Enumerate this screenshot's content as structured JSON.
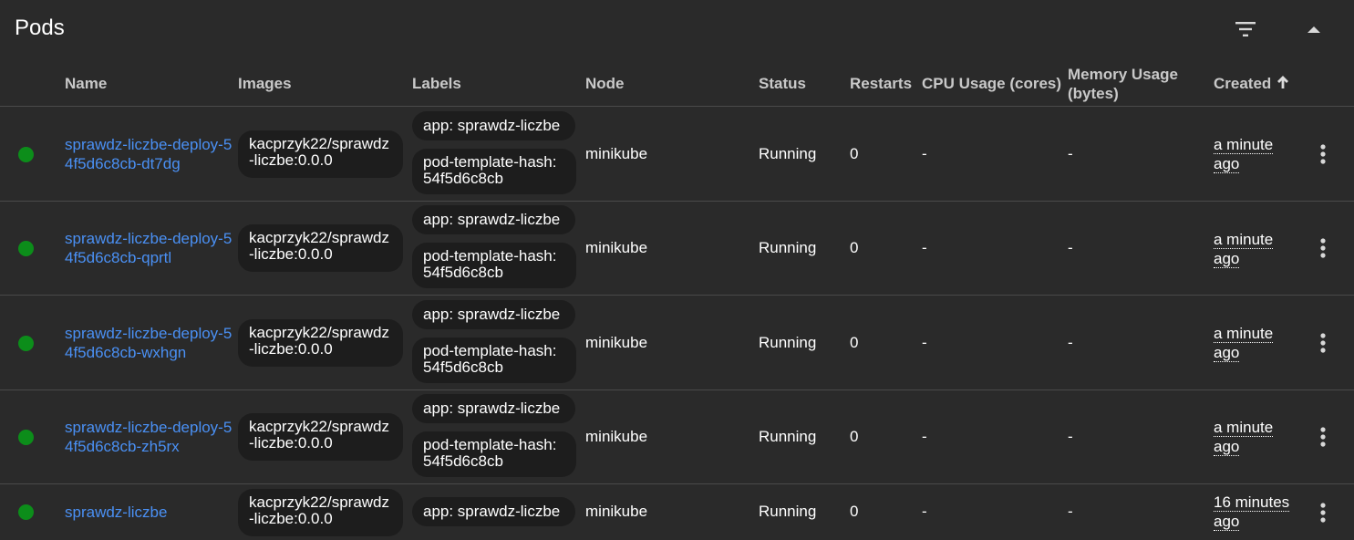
{
  "card": {
    "title": "Pods"
  },
  "toolbar": {
    "filter_icon": "filter-icon",
    "collapse_icon": "chevron-up-icon"
  },
  "table": {
    "columns": {
      "name": "Name",
      "images": "Images",
      "labels": "Labels",
      "node": "Node",
      "status": "Status",
      "restarts": "Restarts",
      "cpu": "CPU Usage (cores)",
      "memory_line1": "Memory Usage",
      "memory_line2": "(bytes)",
      "created": "Created"
    },
    "sort": {
      "column": "created",
      "direction": "ascending",
      "icon": "arrow-up-icon"
    },
    "rows": [
      {
        "status_color": "#0c8d1a",
        "name": "sprawdz-liczbe-deploy-54f5d6c8cb-dt7dg",
        "image": "kacprzyk22/sprawdz-liczbe:0.0.0",
        "labels": [
          "app: sprawdz-liczbe",
          "pod-template-hash: 54f5d6c8cb"
        ],
        "node": "minikube",
        "status": "Running",
        "restarts": "0",
        "cpu": "-",
        "memory": "-",
        "created": "a minute ago"
      },
      {
        "status_color": "#0c8d1a",
        "name": "sprawdz-liczbe-deploy-54f5d6c8cb-qprtl",
        "image": "kacprzyk22/sprawdz-liczbe:0.0.0",
        "labels": [
          "app: sprawdz-liczbe",
          "pod-template-hash: 54f5d6c8cb"
        ],
        "node": "minikube",
        "status": "Running",
        "restarts": "0",
        "cpu": "-",
        "memory": "-",
        "created": "a minute ago"
      },
      {
        "status_color": "#0c8d1a",
        "name": "sprawdz-liczbe-deploy-54f5d6c8cb-wxhgn",
        "image": "kacprzyk22/sprawdz-liczbe:0.0.0",
        "labels": [
          "app: sprawdz-liczbe",
          "pod-template-hash: 54f5d6c8cb"
        ],
        "node": "minikube",
        "status": "Running",
        "restarts": "0",
        "cpu": "-",
        "memory": "-",
        "created": "a minute ago"
      },
      {
        "status_color": "#0c8d1a",
        "name": "sprawdz-liczbe-deploy-54f5d6c8cb-zh5rx",
        "image": "kacprzyk22/sprawdz-liczbe:0.0.0",
        "labels": [
          "app: sprawdz-liczbe",
          "pod-template-hash: 54f5d6c8cb"
        ],
        "node": "minikube",
        "status": "Running",
        "restarts": "0",
        "cpu": "-",
        "memory": "-",
        "created": "a minute ago"
      },
      {
        "status_color": "#0c8d1a",
        "name": "sprawdz-liczbe",
        "image": "kacprzyk22/sprawdz-liczbe:0.0.0",
        "labels": [
          "app: sprawdz-liczbe"
        ],
        "node": "minikube",
        "status": "Running",
        "restarts": "0",
        "cpu": "-",
        "memory": "-",
        "created": "16 minutes ago"
      }
    ],
    "row_menu_icon": "more-vertical-icon"
  }
}
